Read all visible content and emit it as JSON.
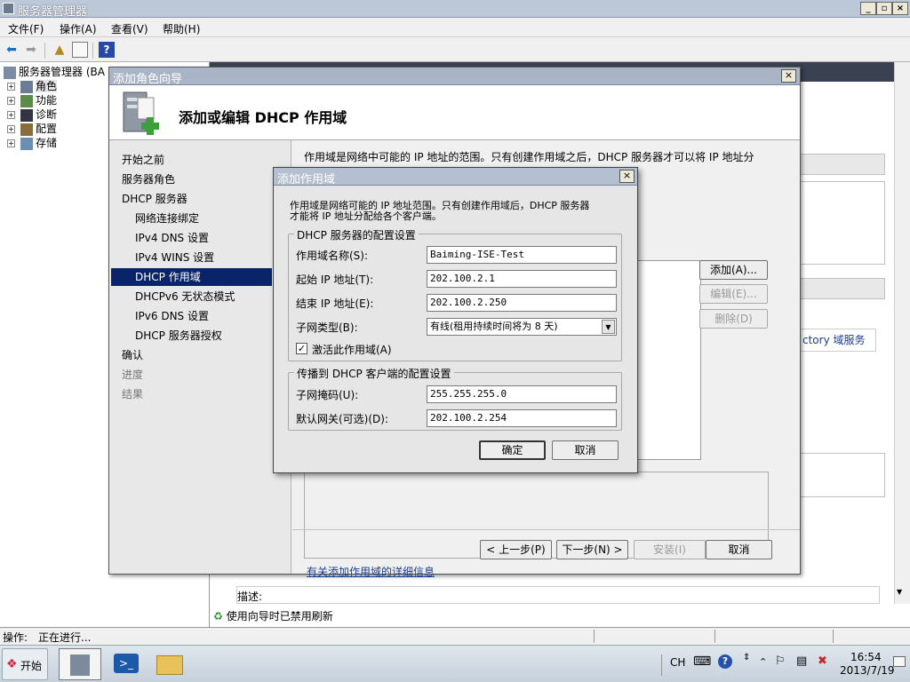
{
  "main_window": {
    "title": "服务器管理器",
    "menu": [
      "文件(F)",
      "操作(A)",
      "查看(V)",
      "帮助(H)"
    ],
    "tree": {
      "root": "服务器管理器 (BA",
      "items": [
        "角色",
        "功能",
        "诊断",
        "配置",
        "存储"
      ]
    },
    "right_pane": {
      "ad_link_fragment": "ctory 域服务",
      "description_label": "描述:",
      "refresh_notice": "使用向导时已禁用刷新"
    },
    "status": {
      "label": "操作:",
      "value": "正在进行..."
    }
  },
  "wizard": {
    "title": "添加角色向导",
    "heading": "添加或编辑 DHCP 作用域",
    "nav": [
      {
        "label": "开始之前",
        "level": 0,
        "state": "normal"
      },
      {
        "label": "服务器角色",
        "level": 0,
        "state": "normal"
      },
      {
        "label": "DHCP 服务器",
        "level": 0,
        "state": "normal"
      },
      {
        "label": "网络连接绑定",
        "level": 1,
        "state": "normal"
      },
      {
        "label": "IPv4 DNS 设置",
        "level": 1,
        "state": "normal"
      },
      {
        "label": "IPv4 WINS 设置",
        "level": 1,
        "state": "normal"
      },
      {
        "label": "DHCP 作用域",
        "level": 1,
        "state": "selected"
      },
      {
        "label": "DHCPv6 无状态模式",
        "level": 1,
        "state": "normal"
      },
      {
        "label": "IPv6 DNS 设置",
        "level": 1,
        "state": "normal"
      },
      {
        "label": "DHCP 服务器授权",
        "level": 1,
        "state": "normal"
      },
      {
        "label": "确认",
        "level": 0,
        "state": "normal"
      },
      {
        "label": "进度",
        "level": 0,
        "state": "dim"
      },
      {
        "label": "结果",
        "level": 0,
        "state": "dim"
      }
    ],
    "intro": "作用域是网络中可能的 IP 地址的范围。只有创建作用域之后，DHCP 服务器才可以将 IP 地址分",
    "side_buttons": {
      "add": "添加(A)...",
      "edit": "编辑(E)...",
      "delete": "删除(D)"
    },
    "more_info_link": "有关添加作用域的详细信息",
    "footer": {
      "back": "< 上一步(P)",
      "next": "下一步(N) >",
      "install": "安装(I)",
      "cancel": "取消"
    }
  },
  "dialog": {
    "title": "添加作用域",
    "intro_line1": "作用域是网络可能的 IP 地址范围。只有创建作用域后，DHCP 服务器",
    "intro_line2": "才能将 IP 地址分配给各个客户端。",
    "group1": {
      "legend": "DHCP 服务器的配置设置",
      "scope_name_label": "作用域名称(S):",
      "scope_name": "Baiming-ISE-Test",
      "start_ip_label": "起始 IP 地址(T):",
      "start_ip": "202.100.2.1",
      "end_ip_label": "结束 IP 地址(E):",
      "end_ip": "202.100.2.250",
      "subnet_type_label": "子网类型(B):",
      "subnet_type": "有线(租用持续时间将为 8 天)",
      "activate_label": "激活此作用域(A)",
      "activate_checked": true
    },
    "group2": {
      "legend": "传播到 DHCP 客户端的配置设置",
      "subnet_mask_label": "子网掩码(U):",
      "subnet_mask": "255.255.255.0",
      "gateway_label": "默认网关(可选)(D):",
      "gateway": "202.100.2.254"
    },
    "ok": "确定",
    "cancel": "取消"
  },
  "taskbar": {
    "start": "开始",
    "lang": "CH",
    "time": "16:54",
    "date": "2013/7/19"
  }
}
